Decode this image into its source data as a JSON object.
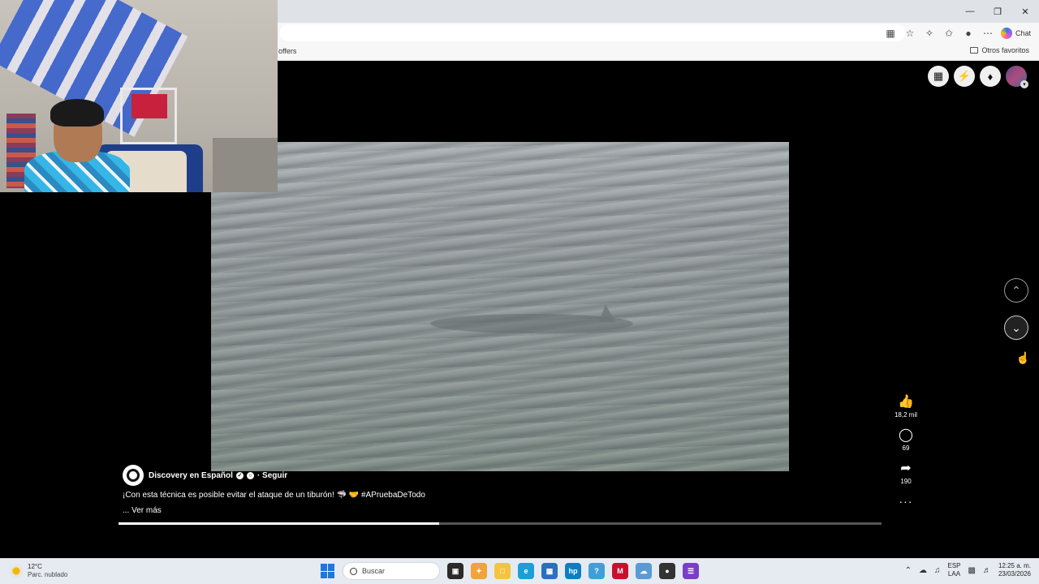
{
  "browser": {
    "bookmarks": {
      "offers_label": "offers",
      "favorites_label": "Otros favoritos"
    },
    "toolbar": {
      "chat_label": "Chat"
    },
    "window_controls": {
      "minimize": "—",
      "restore": "❐",
      "close": "✕"
    }
  },
  "page": {
    "post": {
      "author": "Discovery en Español",
      "follow_label": "· Seguir",
      "caption": "¡Con esta técnica es posible evitar el ataque de un tiburón! 🦈 🤝 #APruebaDeTodo",
      "see_more": "... Ver más",
      "progress_fraction": 0.42
    },
    "actions": {
      "likes": "18,2 mil",
      "comments": "69",
      "shares": "190",
      "more": "···"
    },
    "nav": {
      "up": "⌃",
      "down": "⌄"
    }
  },
  "taskbar": {
    "weather_temp": "12°C",
    "weather_desc": "Parc. nublado",
    "search_placeholder": "Buscar",
    "lang_top": "ESP",
    "lang_bottom": "LAA",
    "time": "12:25 a. m.",
    "date": "23/03/2026"
  },
  "colors": {
    "accent_blue": "#1e78d8",
    "page_bg": "#000000",
    "taskbar_bg": "#e6ebf1"
  }
}
